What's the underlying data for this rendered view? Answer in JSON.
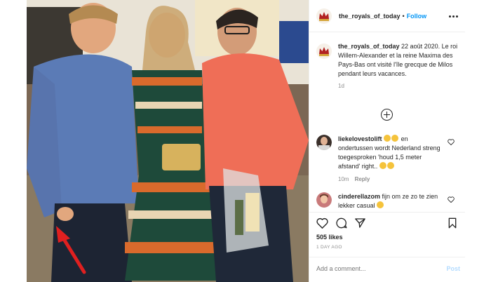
{
  "header": {
    "username": "the_royals_of_today",
    "separator": "•",
    "follow_label": "Follow"
  },
  "caption": {
    "username": "the_royals_of_today",
    "text": "22 août 2020. Le roi Willem-Alexander et la reine Maxima des Pays-Bas ont visité l'île grecque de Milos pendant leurs vacances.",
    "time": "1d"
  },
  "comments": [
    {
      "username": "liekelovestolift",
      "text_before": "en ondertussen wordt Nederland streng toegesproken 'houd 1,5 meter afstand' right..",
      "time": "10m",
      "reply_label": "Reply"
    },
    {
      "username": "cinderellazom",
      "text": "fijn om ze zo te zien lekker casual",
      "time": "",
      "reply_label": ""
    }
  ],
  "stats": {
    "likes": "505 likes",
    "date": "1 DAY AGO"
  },
  "add_comment": {
    "placeholder": "Add a comment...",
    "post_label": "Post"
  },
  "colors": {
    "link_blue": "#0095f6",
    "post_disabled": "#b3dbff",
    "meta_gray": "#8e8e8e",
    "annotation_red": "#e02020"
  },
  "icons": [
    "crown-avatar-icon",
    "more-options-icon",
    "load-more-plus-icon",
    "heart-icon",
    "comment-icon",
    "share-icon",
    "bookmark-icon"
  ]
}
